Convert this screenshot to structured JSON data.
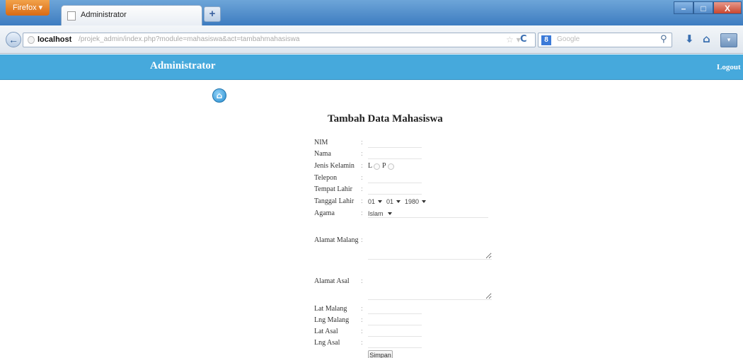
{
  "browser": {
    "app_button": "Firefox",
    "tab_title": "Administrator",
    "new_tab": "+",
    "url_host": "localhost",
    "url_path": "/projek_admin/index.php?module=mahasiswa&act=tambahmahasiswa",
    "search_engine": "8",
    "search_placeholder": "Google",
    "icons": [
      "back-arrow-icon",
      "star-icon",
      "reload-icon",
      "search-icon",
      "download-icon",
      "home-icon",
      "menu-icon"
    ]
  },
  "header": {
    "title": "Administrator",
    "logout": "Logout",
    "color": "#46a9dc"
  },
  "form": {
    "title": "Tambah Data Mahasiswa",
    "labels": {
      "nim": "NIM",
      "nama": "Nama",
      "jenis_kelamin": "Jenis Kelamin",
      "telepon": "Telepon",
      "tempat_lahir": "Tempat Lahir",
      "tanggal_lahir": "Tanggal Lahir",
      "agama": "Agama",
      "alamat_malang": "Alamat Malang",
      "alamat_asal": "Alamat Asal",
      "lat_malang": "Lat Malang",
      "lng_malang": "Lng Malang",
      "lat_asal": "Lat Asal",
      "lng_asal": "Lng Asal"
    },
    "colon": ":",
    "gender_options": [
      "L",
      "P"
    ],
    "tanggal_lahir": {
      "day": "01",
      "month": "01",
      "year": "1980"
    },
    "agama_value": "Islam",
    "submit_label": "Simpan"
  }
}
